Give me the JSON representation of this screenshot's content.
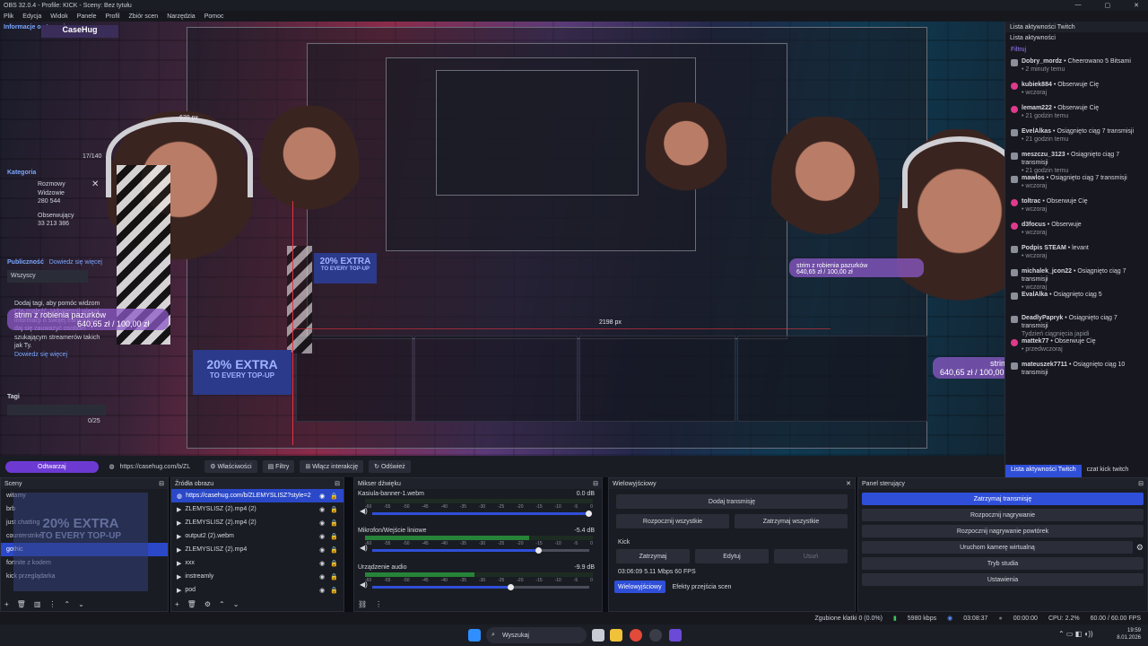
{
  "window": {
    "title": "OBS 32.0.4 - Profile: KICK - Sceny: Bez tytułu"
  },
  "menu": [
    "Plik",
    "Edycja",
    "Widok",
    "Panele",
    "Profil",
    "Zbiór scen",
    "Narzędzia",
    "Pomoc"
  ],
  "preview": {
    "width_label": "2198 px",
    "height_label": "639 px",
    "info_header": "Informacje o streamie",
    "brand": "CaseHug",
    "category_label": "Kategoria",
    "category_value": "Rozmowy",
    "viewers_label": "Widzowie",
    "viewers_value": "280 544",
    "followers_label": "Obserwujący",
    "followers_value": "33 213 386",
    "counter": "17/140",
    "publicity_label": "Publiczność",
    "publicity_link": "Dowiedz się więcej",
    "visibility": "Wszyscy",
    "tags_help": "Dodaj tagi, aby pomóc widzom Cię znaleźć. Udostępnij więcej informacji o swojej transmisji i daj się zauważyć osobom szukającym streamerów takich jak Ty.",
    "tags_link": "Dowiedz się więcej",
    "tags_label": "Tagi",
    "tags_count": "0/25",
    "strim_title": "strim z robienia pazurków",
    "strim_goal": "640,65 zł / 100,00 zł",
    "promo_line1": "20% EXTRA",
    "promo_line2": "TO EVERY TOP-UP"
  },
  "twitch": {
    "title": "Lista aktywności Twitch",
    "subtitle": "Lista aktywności",
    "filter": "Filtruj",
    "items": [
      {
        "name": "Dobry_mordz",
        "text": "• Cheerowano 5 Bitsami",
        "time": "• 2 minuty temu",
        "color": "#8a8f9a"
      },
      {
        "name": "kubiek884",
        "text": "• Obserwuje Cię",
        "time": "• wczoraj",
        "color": "#e03a8c"
      },
      {
        "name": "lemam222",
        "text": "• Obserwuje Cię",
        "time": "• 21 godzin temu",
        "color": "#e03a8c"
      },
      {
        "name": "EvelAlkas",
        "text": "• Osiągnięto ciąg 7 transmisji",
        "time": "• 21 godzin temu",
        "color": "#8a8f9a"
      },
      {
        "name": "meszczu_3123",
        "text": "• Osiągnięto ciąg 7 transmisji",
        "time": "• 21 godzin temu",
        "color": "#8a8f9a"
      },
      {
        "name": "mawlos",
        "text": "• Osiągnięto ciąg 7 transmisji",
        "time": "• wczoraj",
        "color": "#8a8f9a"
      },
      {
        "name": "toltrac",
        "text": "• Obserwuje Cię",
        "time": "• wczoraj",
        "color": "#e03a8c"
      },
      {
        "name": "d3focus",
        "text": "• Obserwuje",
        "time": "• wczoraj",
        "color": "#e03a8c"
      },
      {
        "name": "Podpis STEAM",
        "text": "• levant",
        "time": "• wczoraj",
        "color": "#8a8f9a"
      },
      {
        "name": "michalek_jcon22",
        "text": "• Osiągnięto ciąg 7 transmisji",
        "time": "• wczoraj",
        "color": "#8a8f9a"
      },
      {
        "name": "EvalAlka",
        "text": "• Osiągnięto ciąg 5",
        "time": "",
        "color": "#8a8f9a"
      },
      {
        "name": "DeadlyPapryk",
        "text": "• Osiągnięto ciąg 7 transmisji",
        "time": "Tydzień ciągnięcia japidi",
        "color": "#8a8f9a"
      },
      {
        "name": "mattek77",
        "text": "• Obserwuje Cię",
        "time": "• przedwczoraj",
        "color": "#e03a8c"
      },
      {
        "name": "mateuszek7711",
        "text": "• Osiągnięto ciąg 10 transmisji",
        "time": "",
        "color": "#8a8f9a"
      }
    ],
    "tab_active": "Lista aktywności Twitch",
    "tab_other": "czat kick twitch"
  },
  "source_toolbar": {
    "cta": "Odtwarzaj",
    "url": "https://casehug.com/b/ZL",
    "properties": "Właściwości",
    "filters": "Filtry",
    "interact": "Włącz interakcję",
    "refresh": "Odśwież"
  },
  "scenes": {
    "title": "Sceny",
    "items": [
      "witamy",
      "brb",
      "just chatting",
      "counterstrike",
      "gothic",
      "fortnite z kodem",
      "kick przeglądarka"
    ],
    "selected": 4
  },
  "sources": {
    "title": "Źródła obrazu",
    "items": [
      "https://casehug.com/b/ZLEMYSLISZ?style=2",
      "ZLEMYSLISZ (2).mp4 (2)",
      "ZLEMYSLISZ (2).mp4 (2)",
      "output2 (2).webm",
      "ZLEMYSLISZ (2).mp4",
      "xxx",
      "instreamly",
      "pod"
    ]
  },
  "mixer": {
    "title": "Mikser dźwięku",
    "channels": [
      {
        "name": "Kasiula-banner-1.webm",
        "db": "0.0 dB",
        "level": 0.0,
        "volume": 1.0
      },
      {
        "name": "Mikrofon/Wejście liniowe",
        "db": "-5.4 dB",
        "level": 0.72,
        "volume": 0.77
      },
      {
        "name": "Urządzenie audio",
        "db": "-9.9 dB",
        "level": 0.48,
        "volume": 0.64
      }
    ],
    "ticks": [
      "-60",
      "-55",
      "-50",
      "-45",
      "-40",
      "-35",
      "-30",
      "-25",
      "-20",
      "-15",
      "-10",
      "-5",
      "0"
    ]
  },
  "multistream": {
    "title": "Wielowyjściowy",
    "add": "Dodaj transmisję",
    "start_all": "Rozpocznij wszystkie",
    "stop_all": "Zatrzymaj wszystkie",
    "service": "Kick",
    "stop": "Zatrzymaj",
    "edit": "Edytuj",
    "remove": "Usuń",
    "stats": "03:06:09  5.11 Mbps  60 FPS",
    "tab_active": "Wielowyjściowy",
    "tab_other": "Efekty przejścia scen"
  },
  "controls": {
    "title": "Panel sterujący",
    "stop_stream": "Zatrzymaj transmisję",
    "start_record": "Rozpocznij nagrywanie",
    "start_replay": "Rozpocznij nagrywanie powtórek",
    "virtual_cam": "Uruchom kamerę wirtualną",
    "studio": "Tryb studia",
    "settings": "Ustawienia"
  },
  "status": {
    "dropped": "Zgubione klatki 0 (0.0%)",
    "kbps": "5980 kbps",
    "stream_time": "03:08:37",
    "rec_time": "00:00:00",
    "cpu": "CPU: 2.2%",
    "fps": "60.00 / 60.00 FPS"
  },
  "taskbar": {
    "search": "Wyszukaj",
    "time": "19:59",
    "date": "8.01.2026"
  },
  "colors": {
    "accent": "#2f4fd8",
    "brand": "#7b3fd6",
    "follow": "#e03a8c"
  }
}
